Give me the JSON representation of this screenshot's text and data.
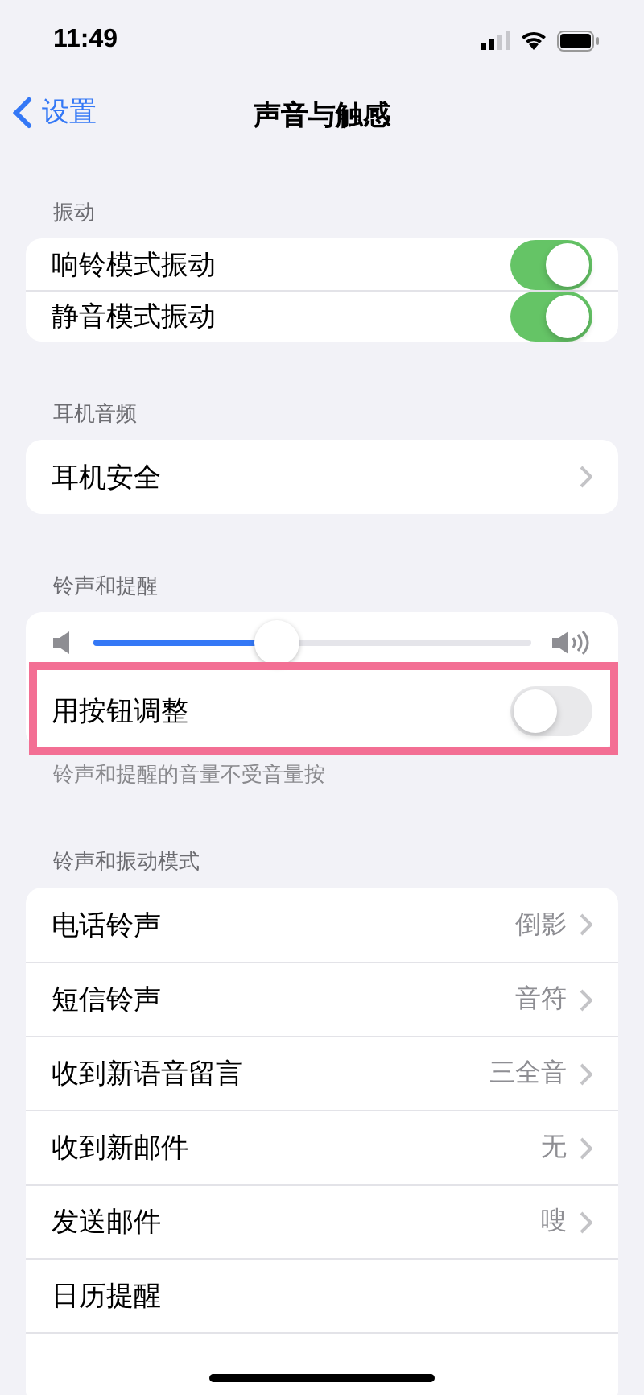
{
  "status_bar": {
    "time": "11:49"
  },
  "nav": {
    "back": "设置",
    "title": "声音与触感"
  },
  "sections": [
    {
      "header": "振动",
      "compact": true,
      "rows": [
        {
          "kind": "toggle",
          "label": "响铃模式振动",
          "on": true
        },
        {
          "kind": "toggle",
          "label": "静音模式振动",
          "on": true
        }
      ]
    },
    {
      "header": "耳机音频",
      "rows": [
        {
          "kind": "link",
          "label": "耳机安全"
        }
      ]
    },
    {
      "header": "铃声和提醒",
      "footer": "铃声和提醒的音量不受音量按",
      "rows": [
        {
          "kind": "slider",
          "level": 0.42
        },
        {
          "kind": "toggle",
          "label": "用按钮调整",
          "on": false,
          "highlighted": true
        }
      ]
    },
    {
      "header": "铃声和振动模式",
      "rows": [
        {
          "kind": "link",
          "label": "电话铃声",
          "value": "倒影"
        },
        {
          "kind": "link",
          "label": "短信铃声",
          "value": "音符"
        },
        {
          "kind": "link",
          "label": "收到新语音留言",
          "value": "三全音"
        },
        {
          "kind": "link",
          "label": "收到新邮件",
          "value": "无"
        },
        {
          "kind": "link",
          "label": "发送邮件",
          "value": "嗖"
        },
        {
          "kind": "plain",
          "label": "日历提醒"
        },
        {
          "kind": "blank"
        }
      ]
    }
  ]
}
